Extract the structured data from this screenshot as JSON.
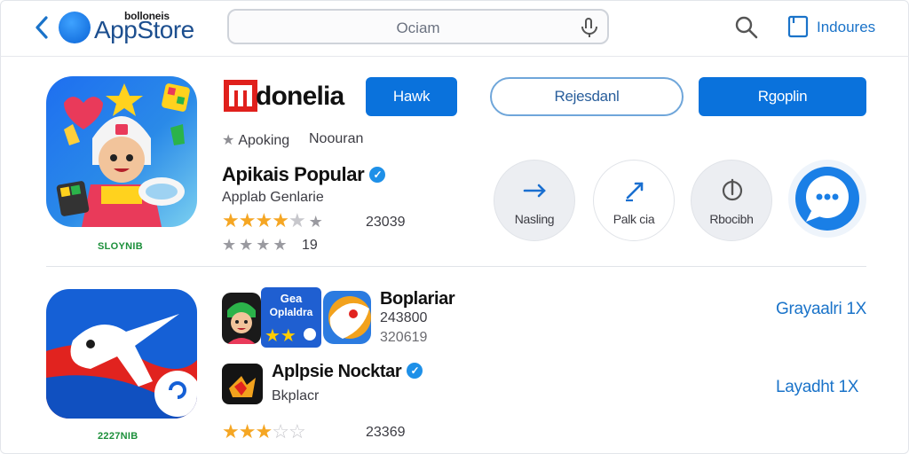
{
  "header": {
    "brand_sup": "bolloneis",
    "brand": "AppStore",
    "search_text": "Ociam",
    "right_link": "Indoures"
  },
  "featured": {
    "icon": "hero-game-icon",
    "caption": "SLOYNIB",
    "title": "donelia",
    "buttons": {
      "primary": "Hawk",
      "outline": "Rejesdanl",
      "right": "Rgoplin"
    },
    "meta": [
      "Apoking",
      "Noouran"
    ],
    "heading": "Apikais Popular",
    "subheading": "Applab Genlarie",
    "rating": 3.5,
    "rating_count": "23039",
    "secondary_count": "19",
    "actions": [
      {
        "label": "Nasling",
        "icon": "arrow-icon"
      },
      {
        "label": "Palk cia",
        "icon": "edit-icon"
      },
      {
        "label": "Rbocibh",
        "icon": "compass-icon"
      }
    ],
    "chat_icon": "chat-icon"
  },
  "second": {
    "icon": "plane-icon",
    "caption": "2227NIB",
    "promo_lines": [
      "Gea",
      "Oplaldra"
    ],
    "title": "Boplariar",
    "numbers": [
      "243800",
      "320619"
    ],
    "heading": "Aplpsie Nocktar",
    "subheading": "Bkplacr",
    "rating": 3.0,
    "rating_count": "23369",
    "links": [
      "Grayaalri 1X",
      "Layadht 1X"
    ]
  },
  "colors": {
    "accent": "#0a72dc",
    "link": "#1a73c9",
    "star": "#f5a623",
    "caption": "#1b8f3a"
  }
}
